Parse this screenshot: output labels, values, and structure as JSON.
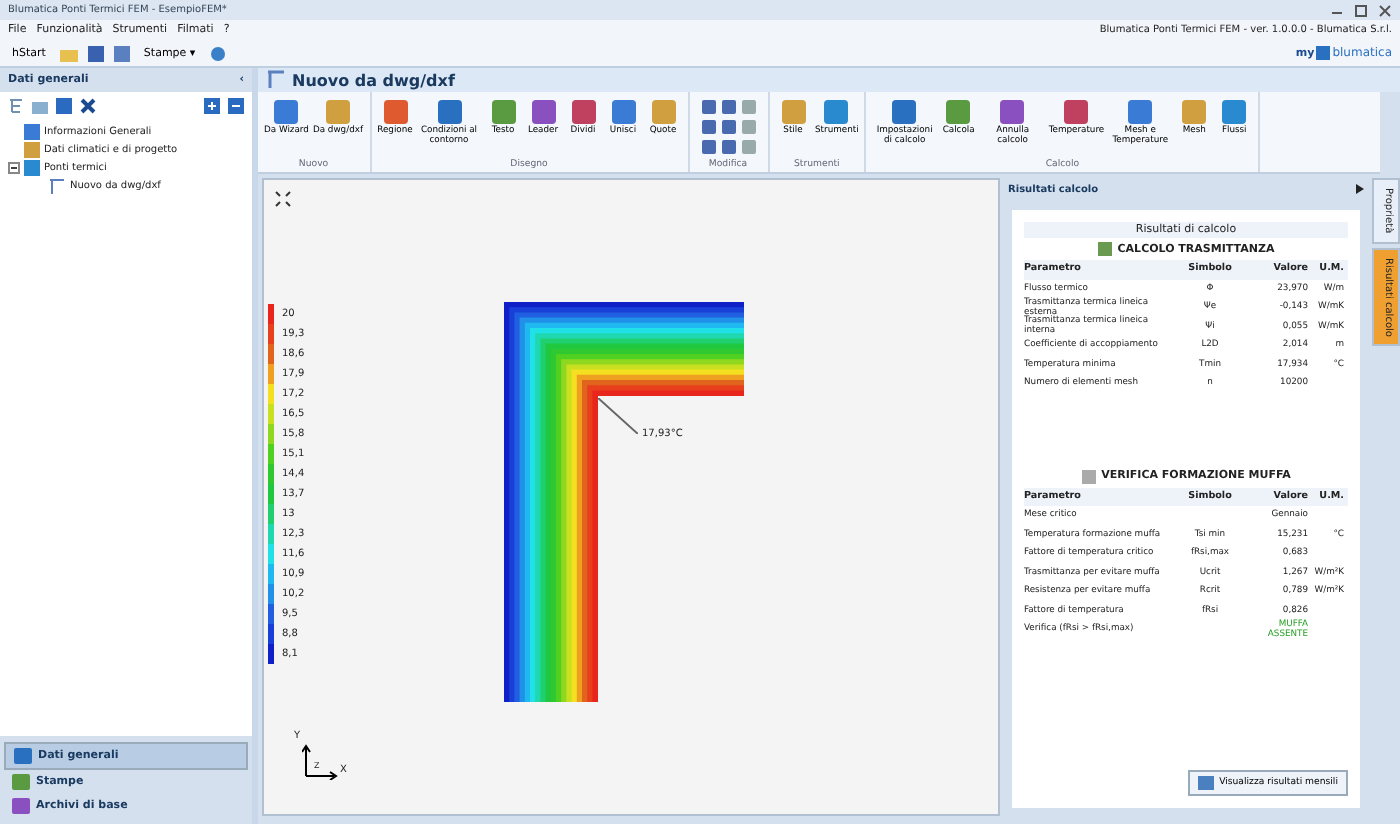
{
  "window": {
    "title": "Blumatica Ponti Termici FEM - EsempioFEM*"
  },
  "menu": [
    "File",
    "Funzionalità",
    "Strumenti",
    "Filmati",
    "?"
  ],
  "toolbar": {
    "start": "hStart",
    "print": "Stampe",
    "print_caret": "▾"
  },
  "app_info": "Blumatica Ponti Termici FEM - ver. 1.0.0.0 - Blumatica S.r.l.",
  "brand": {
    "prefix": "my",
    "name": "blumatica"
  },
  "left_panel": {
    "title": "Dati generali",
    "collapse": "‹",
    "tree": [
      {
        "label": "Informazioni Generali"
      },
      {
        "label": "Dati climatici e di progetto"
      },
      {
        "label": "Ponti termici",
        "expanded": true,
        "children": [
          {
            "label": "Nuovo da dwg/dxf"
          }
        ]
      }
    ],
    "nav": [
      {
        "label": "Dati generali",
        "selected": true
      },
      {
        "label": "Stampe",
        "selected": false
      },
      {
        "label": "Archivi di base",
        "selected": false
      }
    ]
  },
  "document": {
    "title": "Nuovo da dwg/dxf"
  },
  "ribbon": [
    {
      "name": "Nuovo",
      "kind": "large",
      "buttons": [
        "Da Wizard",
        "Da dwg/dxf"
      ]
    },
    {
      "name": "Disegno",
      "kind": "large",
      "buttons": [
        "Regione",
        "Condizioni al contorno",
        "Testo",
        "Leader",
        "Dividi",
        "Unisci",
        "Quote"
      ]
    },
    {
      "name": "Modifica",
      "kind": "small"
    },
    {
      "name": "Strumenti",
      "kind": "large",
      "buttons": [
        "Stile",
        "Strumenti"
      ]
    },
    {
      "name": "Calcolo",
      "kind": "large",
      "buttons": [
        "Impostazioni di calcolo",
        "Calcola",
        "Annulla calcolo",
        "Temperature",
        "Mesh e Temperature",
        "Mesh",
        "Flussi"
      ]
    }
  ],
  "legend": [
    {
      "value": "20",
      "color": "#e8261c"
    },
    {
      "value": "19,3",
      "color": "#e8401c"
    },
    {
      "value": "18,6",
      "color": "#e0641c"
    },
    {
      "value": "17,9",
      "color": "#f0a020"
    },
    {
      "value": "17,2",
      "color": "#f4e020"
    },
    {
      "value": "16,5",
      "color": "#c8e020"
    },
    {
      "value": "15,8",
      "color": "#90d820"
    },
    {
      "value": "15,1",
      "color": "#50d020"
    },
    {
      "value": "14,4",
      "color": "#30c830"
    },
    {
      "value": "13,7",
      "color": "#20c840"
    },
    {
      "value": "13",
      "color": "#20d070"
    },
    {
      "value": "12,3",
      "color": "#20d8b0"
    },
    {
      "value": "11,6",
      "color": "#20e0e8"
    },
    {
      "value": "10,9",
      "color": "#20b8f0"
    },
    {
      "value": "10,2",
      "color": "#2090e8"
    },
    {
      "value": "9,5",
      "color": "#2060e0"
    },
    {
      "value": "8,8",
      "color": "#1840d8"
    },
    {
      "value": "8,1",
      "color": "#1020c8"
    }
  ],
  "point_label": "17,93°C",
  "axes": {
    "y": "Y",
    "x": "X",
    "z": "Z"
  },
  "results": {
    "header": "Risultati calcolo",
    "title": "Risultati di calcolo",
    "sections": [
      {
        "title": "CALCOLO TRASMITTANZA",
        "columns": [
          "Parametro",
          "Simbolo",
          "Valore",
          "U.M."
        ],
        "rows": [
          {
            "kind": "plain",
            "cells": [
              "Flusso termico",
              "Φ",
              "23,970",
              "W/m"
            ]
          },
          {
            "kind": "plain",
            "cells": [
              "Trasmittanza termica lineica esterna",
              "Ψe",
              "-0,143",
              "W/mK"
            ]
          },
          {
            "kind": "plain",
            "cells": [
              "Trasmittanza termica lineica interna",
              "Ψi",
              "0,055",
              "W/mK"
            ]
          },
          {
            "kind": "plain",
            "cells": [
              "Coefficiente di accoppiamento",
              "L2D",
              "2,014",
              "m"
            ]
          },
          {
            "kind": "plain",
            "cells": [
              "Temperatura minima",
              "Tmin",
              "17,934",
              "°C"
            ]
          },
          {
            "kind": "plain",
            "cells": [
              "Numero di elementi mesh",
              "n",
              "10200",
              ""
            ]
          }
        ]
      },
      {
        "title": "VERIFICA FORMAZIONE MUFFA",
        "columns": [
          "Parametro",
          "Simbolo",
          "Valore",
          "U.M."
        ],
        "rows": [
          {
            "kind": "plain",
            "cells": [
              "Mese critico",
              "",
              "Gennaio",
              ""
            ]
          },
          {
            "kind": "plain",
            "cells": [
              "Temperatura formazione muffa",
              "Tsi min",
              "15,231",
              "°C"
            ]
          },
          {
            "kind": "plain",
            "cells": [
              "Fattore di temperatura critico",
              "fRsi,max",
              "0,683",
              ""
            ]
          },
          {
            "kind": "plain",
            "cells": [
              "Trasmittanza per evitare muffa",
              "Ucrit",
              "1,267",
              "W/m²K"
            ]
          },
          {
            "kind": "plain",
            "cells": [
              "Resistenza per evitare muffa",
              "Rcrit",
              "0,789",
              "W/m²K"
            ]
          },
          {
            "kind": "plain",
            "cells": [
              "Fattore di temperatura",
              "fRsi",
              "0,826",
              ""
            ]
          },
          {
            "kind": "verdict",
            "cells": [
              "Verifica (fRsi > fRsi,max)",
              "",
              "MUFFA ASSENTE",
              ""
            ]
          }
        ]
      }
    ],
    "button": "Visualizza risultati mensili"
  },
  "side_tabs": [
    {
      "label": "Proprietà",
      "selected": false
    },
    {
      "label": "Risultati calcolo",
      "selected": true
    }
  ]
}
